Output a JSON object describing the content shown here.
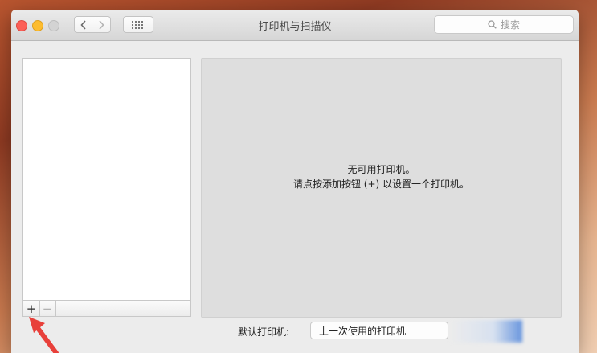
{
  "window": {
    "title": "打印机与扫描仪"
  },
  "toolbar": {
    "back_icon": "chevron-left-icon",
    "forward_icon": "chevron-right-icon",
    "grid_icon": "grid-icon",
    "search_placeholder": "搜索"
  },
  "printer_list": {
    "items": [],
    "add_label": "+",
    "remove_label": "−"
  },
  "detail": {
    "empty_line1": "无可用打印机。",
    "empty_line2": "请点按添加按钮 (+) 以设置一个打印机。"
  },
  "footer": {
    "default_printer_label": "默认打印机:",
    "default_printer_value": "上一次使用的打印机"
  },
  "colors": {
    "close": "#fc5f57",
    "minimize": "#fdbc2e",
    "annotation_arrow": "#e8403a"
  }
}
